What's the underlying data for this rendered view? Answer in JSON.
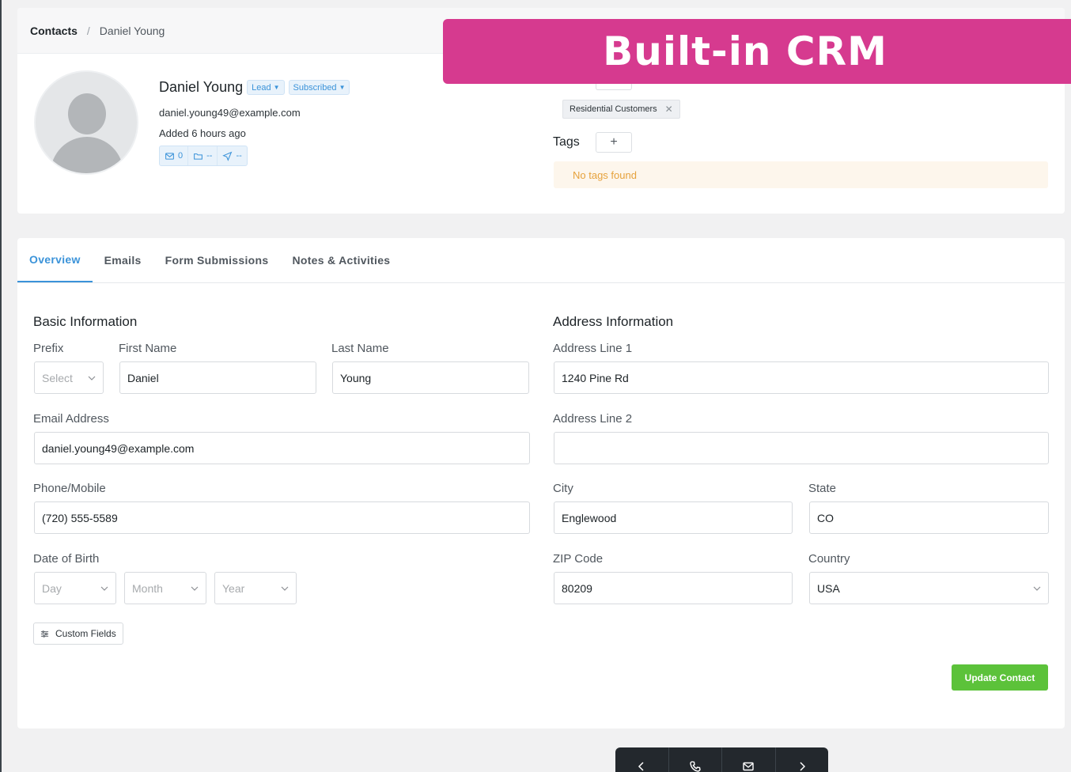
{
  "banner": {
    "text": "Built-in CRM"
  },
  "breadcrumb": {
    "root": "Contacts",
    "separator": "/",
    "current": "Daniel Young"
  },
  "contact": {
    "name": "Daniel Young",
    "status_badge": "Lead",
    "subscription_badge": "Subscribed",
    "email": "daniel.young49@example.com",
    "added": "Added 6 hours ago",
    "stats": {
      "emails": "0",
      "folders": "--",
      "sent": "--"
    }
  },
  "lists": {
    "chip_label": "Residential Customers"
  },
  "tags": {
    "label": "Tags",
    "add": "+",
    "empty_message": "No tags found"
  },
  "tabs": [
    {
      "label": "Overview"
    },
    {
      "label": "Emails"
    },
    {
      "label": "Form Submissions"
    },
    {
      "label": "Notes & Activities"
    }
  ],
  "basic": {
    "title": "Basic Information",
    "prefix_label": "Prefix",
    "prefix_placeholder": "Select",
    "first_name_label": "First Name",
    "first_name": "Daniel",
    "last_name_label": "Last Name",
    "last_name": "Young",
    "email_label": "Email Address",
    "email": "daniel.young49@example.com",
    "phone_label": "Phone/Mobile",
    "phone": "(720) 555-5589",
    "dob_label": "Date of Birth",
    "dob_day": "Day",
    "dob_month": "Month",
    "dob_year": "Year",
    "custom_fields": "Custom Fields"
  },
  "address": {
    "title": "Address Information",
    "line1_label": "Address Line 1",
    "line1": "1240 Pine Rd",
    "line2_label": "Address Line 2",
    "line2": "",
    "city_label": "City",
    "city": "Englewood",
    "state_label": "State",
    "state": "CO",
    "zip_label": "ZIP Code",
    "zip": "80209",
    "country_label": "Country",
    "country": "USA"
  },
  "actions": {
    "update": "Update Contact"
  },
  "colors": {
    "accent": "#3b93d9",
    "banner": "#d63a8f",
    "success": "#5cc23a",
    "warning": "#e6a23c"
  }
}
